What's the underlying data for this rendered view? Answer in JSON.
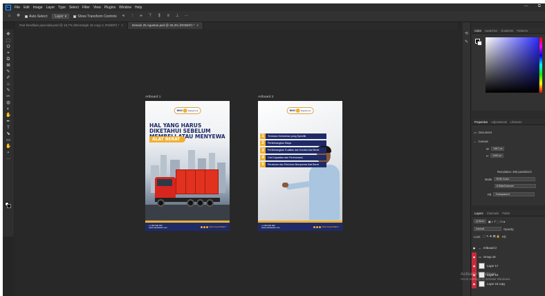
{
  "app": {
    "logo": "Ps",
    "menu": [
      "File",
      "Edit",
      "Image",
      "Layer",
      "Type",
      "Select",
      "Filter",
      "View",
      "Plugins",
      "Window",
      "Help"
    ],
    "window_controls": [
      "—",
      "⧉"
    ]
  },
  "options_bar": {
    "auto_select_label": "Auto-Select:",
    "auto_select_target": "Layer",
    "show_transform_label": "Show Transform Controls",
    "more": "···"
  },
  "tabs": [
    {
      "label": "Part kendikan pancadia.psd @ 16,7% (Rectangle 16 copy 2, RGB/8*) *",
      "active": false
    },
    {
      "label": "Desain 25 Agustus.psd @ 25,3% (RGB/8*) *",
      "active": true
    }
  ],
  "tools": [
    "✥",
    "⬚",
    "ʘ",
    "⌖",
    "⧉",
    "⊠",
    "✎",
    "✐",
    "♨",
    "✎",
    "✂",
    "◍",
    "◐",
    "✋",
    "✒",
    "T",
    "⬊",
    "▭",
    "✋",
    "⌕",
    "···"
  ],
  "artboards": [
    {
      "label": "Artboard 1",
      "brand": "MINO",
      "brand_sub": "Equipment",
      "headline": "HAL YANG HARUS DIKETAHUI SEBELUM MEMBELI ATAU MENYEWA",
      "highlight": "ALAT BERAT",
      "footer_contact": "+1 000 000 000\nwww.websiteabc.com",
      "footer_social": "MINO EQUIPMENT"
    },
    {
      "label": "Artboard 2",
      "brand": "MINO",
      "brand_sub": "Equipment",
      "list": [
        {
          "n": "1",
          "text": "Tentukan Kebutuhan yang Spesifik"
        },
        {
          "n": "2",
          "text": "Pertimbangkan Biaya"
        },
        {
          "n": "3",
          "text": "Pertimbangkan Kualitas dan Kondisi Alat Berat"
        },
        {
          "n": "4",
          "text": "Cek Kapasitas dan Performansi"
        },
        {
          "n": "5",
          "text": "Peraturan dan Perizinan Beroperasi Alat Berat"
        }
      ],
      "footer_contact": "+1 000 000 000\nwww.websiteabc.com",
      "footer_social": "MINO EQUIPMENT"
    }
  ],
  "color_panel": {
    "tabs": [
      "Color",
      "Swatches",
      "Gradients",
      "Patterns"
    ],
    "colors": {
      "foreground": "#000000",
      "background": "#ffffff",
      "accent": "#2c2cff"
    }
  },
  "properties_panel": {
    "tabs": [
      "Properties",
      "Adjustments",
      "Libraries"
    ],
    "doc_label": "Document",
    "canvas_label": "Canvas",
    "w_label": "W",
    "w_value": "1467 px",
    "h_label": "H",
    "h_value": "1169 px",
    "resolution": "Resolution: 300 pixels/inch",
    "mode_label": "Mode",
    "mode_value": "RGB Color",
    "depth_value": "8 Bits/Channel",
    "fill_label": "Fill",
    "fill_value": "Transparent"
  },
  "layers_panel": {
    "tabs": [
      "Layers",
      "Channels",
      "Paths"
    ],
    "kind_label": "Q Kind",
    "mode_label": "Normal",
    "opacity_label": "Opacity:",
    "lock_label": "Lock:",
    "fill_label": "Fill:",
    "layers": [
      {
        "name": "Artboard 2",
        "type": "artboard"
      },
      {
        "name": "Group 18",
        "type": "group"
      },
      {
        "name": "Layer 17",
        "type": "layer"
      },
      {
        "name": "Layer 16",
        "type": "layer"
      },
      {
        "name": "Layer 15 copy",
        "type": "layer"
      }
    ]
  },
  "watermark": {
    "line1": "Activate Windows",
    "line2": "Go to Settings to activate Windows."
  }
}
